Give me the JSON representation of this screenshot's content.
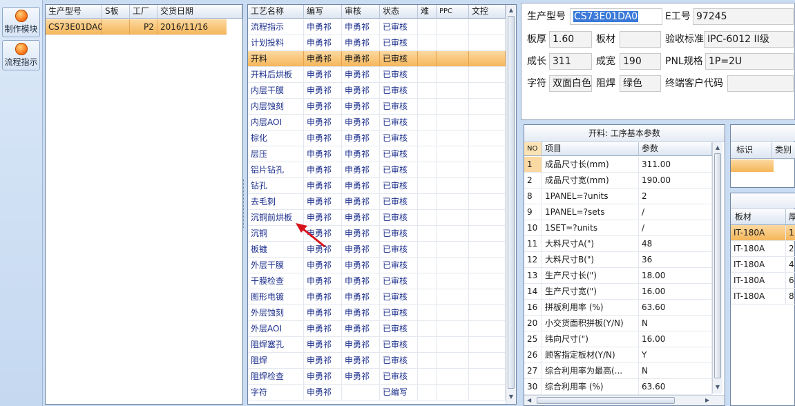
{
  "toolbar": {
    "items": [
      {
        "label": "制作模块",
        "icon": "module-icon"
      },
      {
        "label": "流程指示",
        "icon": "process-icon"
      }
    ]
  },
  "orders": {
    "headers": [
      "生产型号",
      "S板",
      "工厂",
      "交货日期"
    ],
    "rows": [
      [
        "CS73E01DA0",
        "",
        "P2",
        "2016/11/16"
      ]
    ]
  },
  "process": {
    "headers": [
      "工艺名称",
      "编写",
      "审核",
      "状态",
      "难",
      "PPC",
      "文控"
    ],
    "rows": [
      [
        "流程指示",
        "申勇祁",
        "申勇祁",
        "已审核"
      ],
      [
        "计划投料",
        "申勇祁",
        "申勇祁",
        "已审核"
      ],
      [
        "开料",
        "申勇祁",
        "申勇祁",
        "已审核"
      ],
      [
        "开料后烘板",
        "申勇祁",
        "申勇祁",
        "已审核"
      ],
      [
        "内层干膜",
        "申勇祁",
        "申勇祁",
        "已审核"
      ],
      [
        "内层蚀刻",
        "申勇祁",
        "申勇祁",
        "已审核"
      ],
      [
        "内层AOI",
        "申勇祁",
        "申勇祁",
        "已审核"
      ],
      [
        "棕化",
        "申勇祁",
        "申勇祁",
        "已审核"
      ],
      [
        "层压",
        "申勇祁",
        "申勇祁",
        "已审核"
      ],
      [
        "铝片钻孔",
        "申勇祁",
        "申勇祁",
        "已审核"
      ],
      [
        "钻孔",
        "申勇祁",
        "申勇祁",
        "已审核"
      ],
      [
        "去毛刺",
        "申勇祁",
        "申勇祁",
        "已审核"
      ],
      [
        "沉铜前烘板",
        "申勇祁",
        "申勇祁",
        "已审核"
      ],
      [
        "沉铜",
        "申勇祁",
        "申勇祁",
        "已审核"
      ],
      [
        "板镀",
        "申勇祁",
        "申勇祁",
        "已审核"
      ],
      [
        "外层干膜",
        "申勇祁",
        "申勇祁",
        "已审核"
      ],
      [
        "干膜检查",
        "申勇祁",
        "申勇祁",
        "已审核"
      ],
      [
        "图形电镀",
        "申勇祁",
        "申勇祁",
        "已审核"
      ],
      [
        "外层蚀刻",
        "申勇祁",
        "申勇祁",
        "已审核"
      ],
      [
        "外层AOI",
        "申勇祁",
        "申勇祁",
        "已审核"
      ],
      [
        "阻焊塞孔",
        "申勇祁",
        "申勇祁",
        "已审核"
      ],
      [
        "阻焊",
        "申勇祁",
        "申勇祁",
        "已审核"
      ],
      [
        "阻焊检查",
        "申勇祁",
        "申勇祁",
        "已审核"
      ],
      [
        "字符",
        "申勇祁",
        "",
        "已编写"
      ]
    ]
  },
  "info": {
    "model_label": "生产型号",
    "model_value": "CS73E01DA0",
    "e_label": "E工号",
    "e_value": "97245",
    "thickness_label": "板厚",
    "thickness_value": "1.60",
    "material_label": "板材",
    "material_value": "",
    "standard_label": "验收标准",
    "standard_value": "IPC-6012 II级",
    "length_label": "成长",
    "length_value": "311",
    "width_label": "成宽",
    "width_value": "190",
    "pnl_label": "PNL规格",
    "pnl_value": "1P=2U",
    "char_label": "字符",
    "char_value": "双面白色",
    "mask_label": "阻焊",
    "mask_value": "绿色",
    "customer_label": "终端客户代码",
    "customer_value": ""
  },
  "params": {
    "title": "开料: 工序基本参数",
    "headers": [
      "NO",
      "项目",
      "参数"
    ],
    "rows": [
      [
        "1",
        "成品尺寸长(mm)",
        "311.00"
      ],
      [
        "2",
        "成品尺寸宽(mm)",
        "190.00"
      ],
      [
        "8",
        "1PANEL=?units",
        "2"
      ],
      [
        "9",
        "1PANEL=?sets",
        "/"
      ],
      [
        "10",
        "1SET=?units",
        "/"
      ],
      [
        "11",
        "大料尺寸A(\")",
        "48"
      ],
      [
        "12",
        "大料尺寸B(\")",
        "36"
      ],
      [
        "13",
        "生产尺寸长(\")",
        "18.00"
      ],
      [
        "14",
        "生产尺寸宽(\")",
        "16.00"
      ],
      [
        "16",
        "拼板利用率 (%)",
        "63.60"
      ],
      [
        "20",
        "小交货面积拼板(Y/N)",
        "N"
      ],
      [
        "25",
        "纬向尺寸(\")",
        "16.00"
      ],
      [
        "26",
        "顾客指定板材(Y/N)",
        "Y"
      ],
      [
        "27",
        "综合利用率为最高(...",
        "N"
      ],
      [
        "30",
        "综合利用率 (%)",
        "63.60"
      ]
    ]
  },
  "mark_table": {
    "headers": [
      "标识",
      "类别"
    ]
  },
  "material_table": {
    "headers": [
      "板材",
      "厚"
    ],
    "rows": [
      [
        "IT-180A",
        "1"
      ],
      [
        "IT-180A",
        "2."
      ],
      [
        "IT-180A",
        "4."
      ],
      [
        "IT-180A",
        "6."
      ],
      [
        "IT-180A",
        "8."
      ]
    ]
  }
}
